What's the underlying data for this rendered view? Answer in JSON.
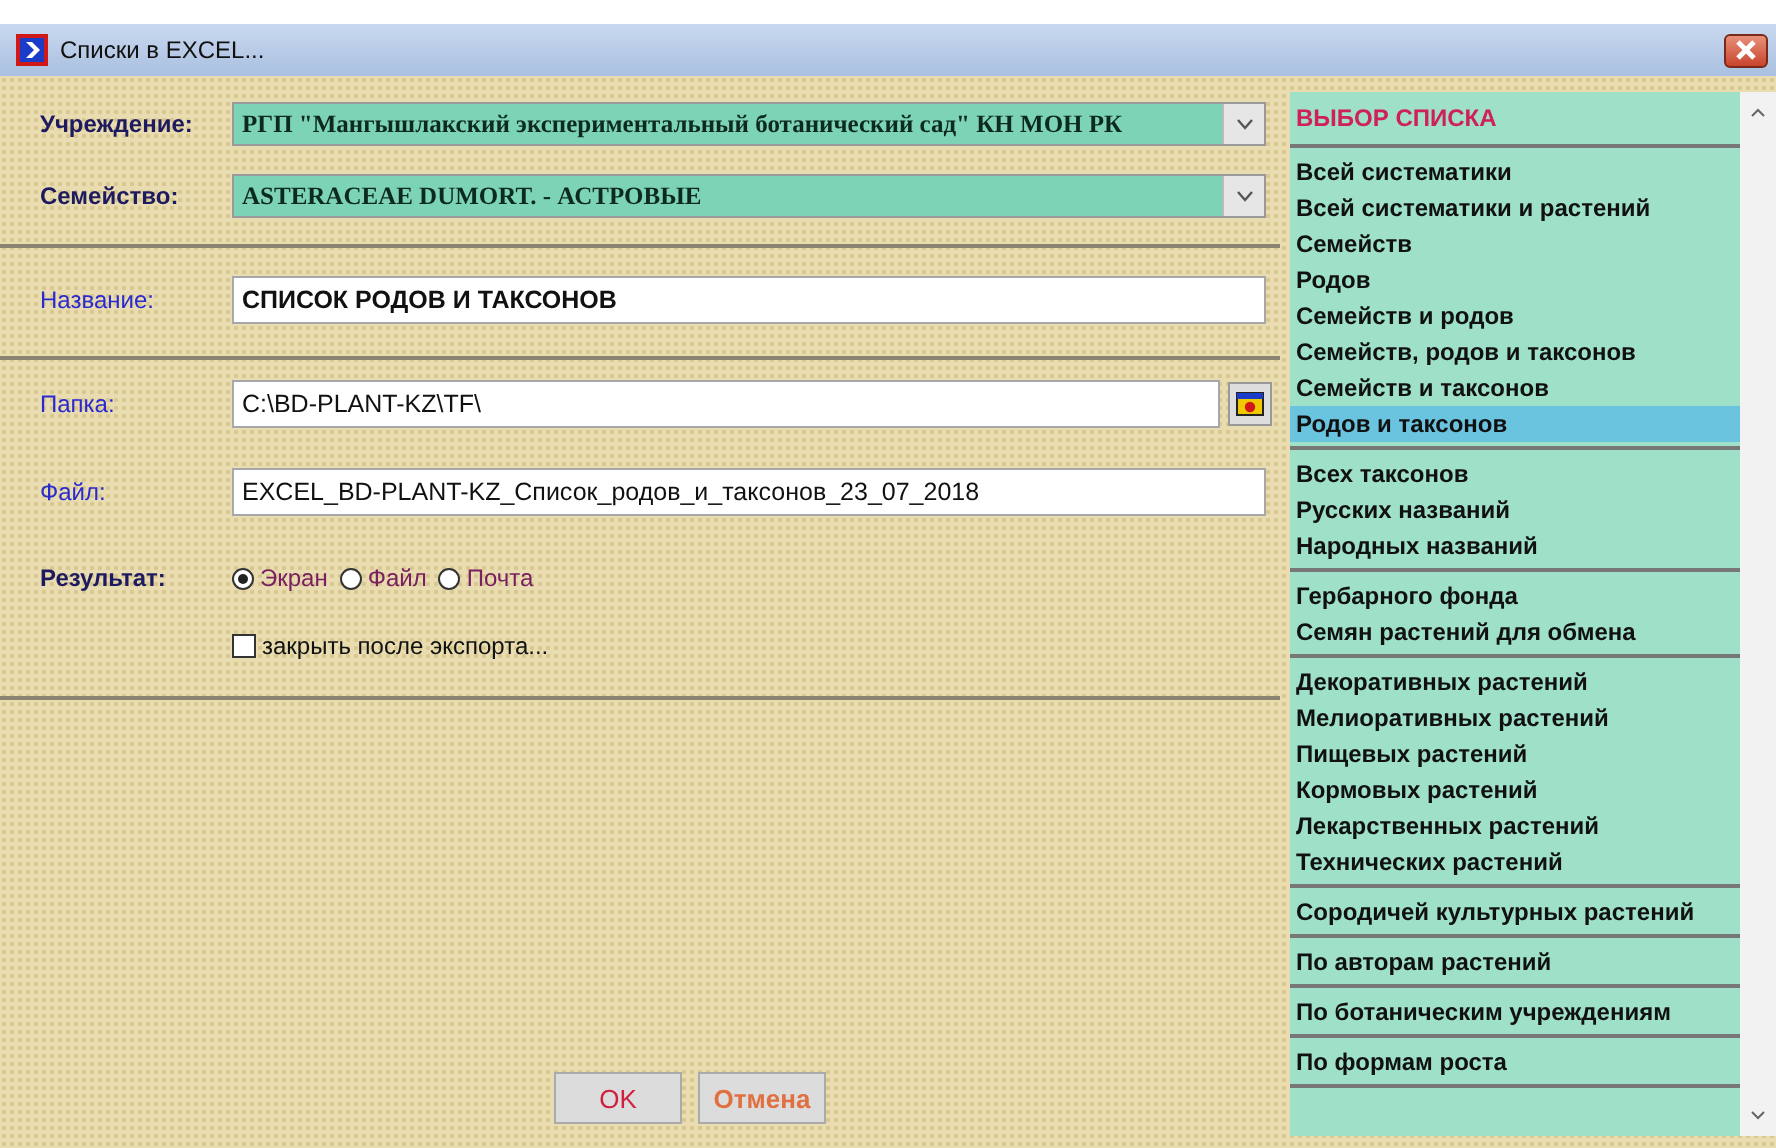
{
  "window": {
    "title": "Списки в EXCEL..."
  },
  "form": {
    "institution": {
      "label": "Учреждение:",
      "value": "РГП \"Мангышлакский экспериментальный ботанический сад\" КН МОН РК"
    },
    "family": {
      "label": "Семейство:",
      "value": "ASTERACEAE DUMORT. - АСТРОВЫЕ"
    },
    "name": {
      "label": "Название:",
      "value": "СПИСОК РОДОВ И ТАКСОНОВ"
    },
    "folder": {
      "label": "Папка:",
      "value": "C:\\BD-PLANT-KZ\\TF\\"
    },
    "file": {
      "label": "Файл:",
      "value": "EXCEL_BD-PLANT-KZ_Список_родов_и_таксонов_23_07_2018"
    },
    "result": {
      "label": "Результат:",
      "options": [
        {
          "label": "Экран",
          "selected": true
        },
        {
          "label": "Файл",
          "selected": false
        },
        {
          "label": "Почта",
          "selected": false
        }
      ]
    },
    "close_after": {
      "label": "закрыть после экспорта...",
      "checked": false
    }
  },
  "buttons": [
    {
      "label": "OK",
      "kind": "ok"
    },
    {
      "label": "Отмена",
      "kind": "cancel"
    }
  ],
  "list": {
    "title": "ВЫБОР СПИСКА",
    "groups": [
      [
        {
          "label": "Всей систематики",
          "selected": false
        },
        {
          "label": "Всей систематики и растений",
          "selected": false
        },
        {
          "label": "Семейств",
          "selected": false
        },
        {
          "label": "Родов",
          "selected": false
        },
        {
          "label": "Семейств и родов",
          "selected": false
        },
        {
          "label": "Семейств, родов и таксонов",
          "selected": false
        },
        {
          "label": "Семейств и таксонов",
          "selected": false
        },
        {
          "label": "Родов и таксонов",
          "selected": true
        }
      ],
      [
        {
          "label": "Всех таксонов",
          "selected": false
        },
        {
          "label": "Русских названий",
          "selected": false
        },
        {
          "label": "Народных названий",
          "selected": false
        }
      ],
      [
        {
          "label": "Гербарного фонда",
          "selected": false
        },
        {
          "label": "Семян растений для обмена",
          "selected": false
        }
      ],
      [
        {
          "label": "Декоративных растений",
          "selected": false
        },
        {
          "label": "Мелиоративных растений",
          "selected": false
        },
        {
          "label": "Пищевых растений",
          "selected": false
        },
        {
          "label": "Кормовых растений",
          "selected": false
        },
        {
          "label": "Лекарственных растений",
          "selected": false
        },
        {
          "label": "Технических растений",
          "selected": false
        }
      ],
      [
        {
          "label": "Сородичей культурных растений",
          "selected": false
        }
      ],
      [
        {
          "label": "По авторам растений",
          "selected": false
        }
      ],
      [
        {
          "label": "По ботаническим учреждениям",
          "selected": false
        }
      ],
      [
        {
          "label": "По формам роста",
          "selected": false
        }
      ]
    ]
  }
}
